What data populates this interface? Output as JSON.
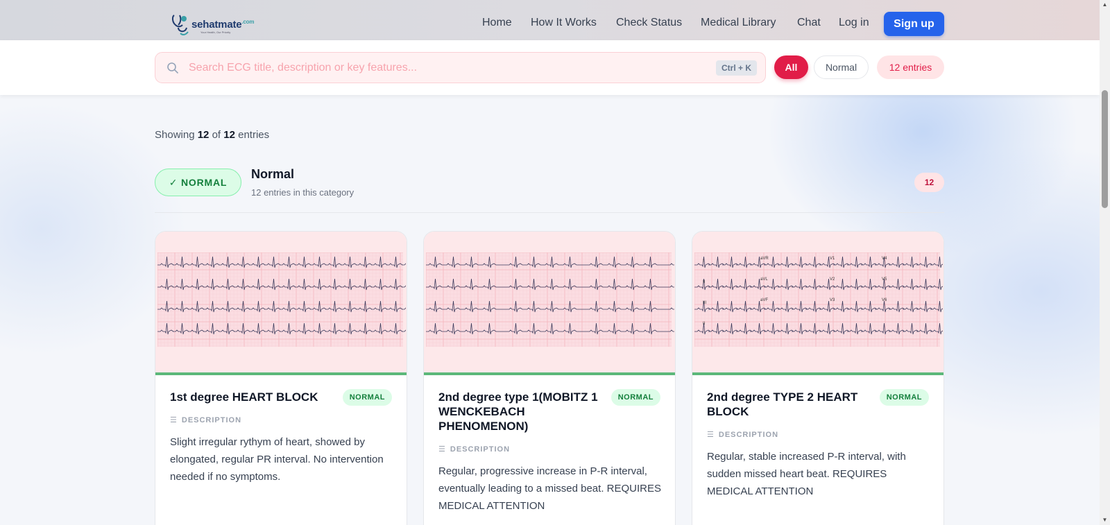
{
  "brand": {
    "name": "sehatmate",
    "suffix": ".com",
    "tagline": "Your Health, Our Priority"
  },
  "nav": {
    "links": [
      "Home",
      "How It Works",
      "Check Status",
      "Medical Library",
      "Chat",
      "Log in"
    ],
    "signup_label": "Sign up"
  },
  "search": {
    "placeholder": "Search ECG title, description or key features...",
    "value": "",
    "shortcut": "Ctrl + K"
  },
  "filters": {
    "all_label": "All",
    "normal_label": "Normal",
    "count_label": "12 entries",
    "active": "All"
  },
  "results": {
    "prefix": "Showing",
    "shown": "12",
    "of": "of",
    "total": "12",
    "suffix": "entries"
  },
  "category": {
    "badge": "✓ NORMAL",
    "title": "Normal",
    "subtitle": "12 entries in this category",
    "count": "12"
  },
  "cards": [
    {
      "title": "1st degree HEART BLOCK",
      "badge": "NORMAL",
      "desc_label": "DESCRIPTION",
      "description": "Slight irregular rythym of heart, showed by elongated, regular PR interval. No intervention needed if no symptoms."
    },
    {
      "title": "2nd degree type 1(MOBITZ 1 WENCKEBACH PHENOMENON)",
      "badge": "NORMAL",
      "desc_label": "DESCRIPTION",
      "description": "Regular, progressive increase in P-R interval, eventually leading to a missed beat. REQUIRES MEDICAL ATTENTION"
    },
    {
      "title": "2nd degree TYPE 2 HEART BLOCK",
      "badge": "NORMAL",
      "desc_label": "DESCRIPTION",
      "description": "Regular, stable increased P-R interval, with sudden missed heart beat. REQUIRES MEDICAL ATTENTION"
    }
  ],
  "ecg_leads": [
    "I",
    "aVR",
    "V1",
    "V4",
    "II",
    "aVL",
    "V2",
    "V5",
    "III",
    "aVF",
    "V3",
    "V6",
    "II"
  ],
  "colors": {
    "primary": "#2563eb",
    "accent": "#e11d48",
    "success": "#15803d",
    "ecg_grid": "#f4b5bd",
    "ecg_trace": "#3b3b5c"
  }
}
